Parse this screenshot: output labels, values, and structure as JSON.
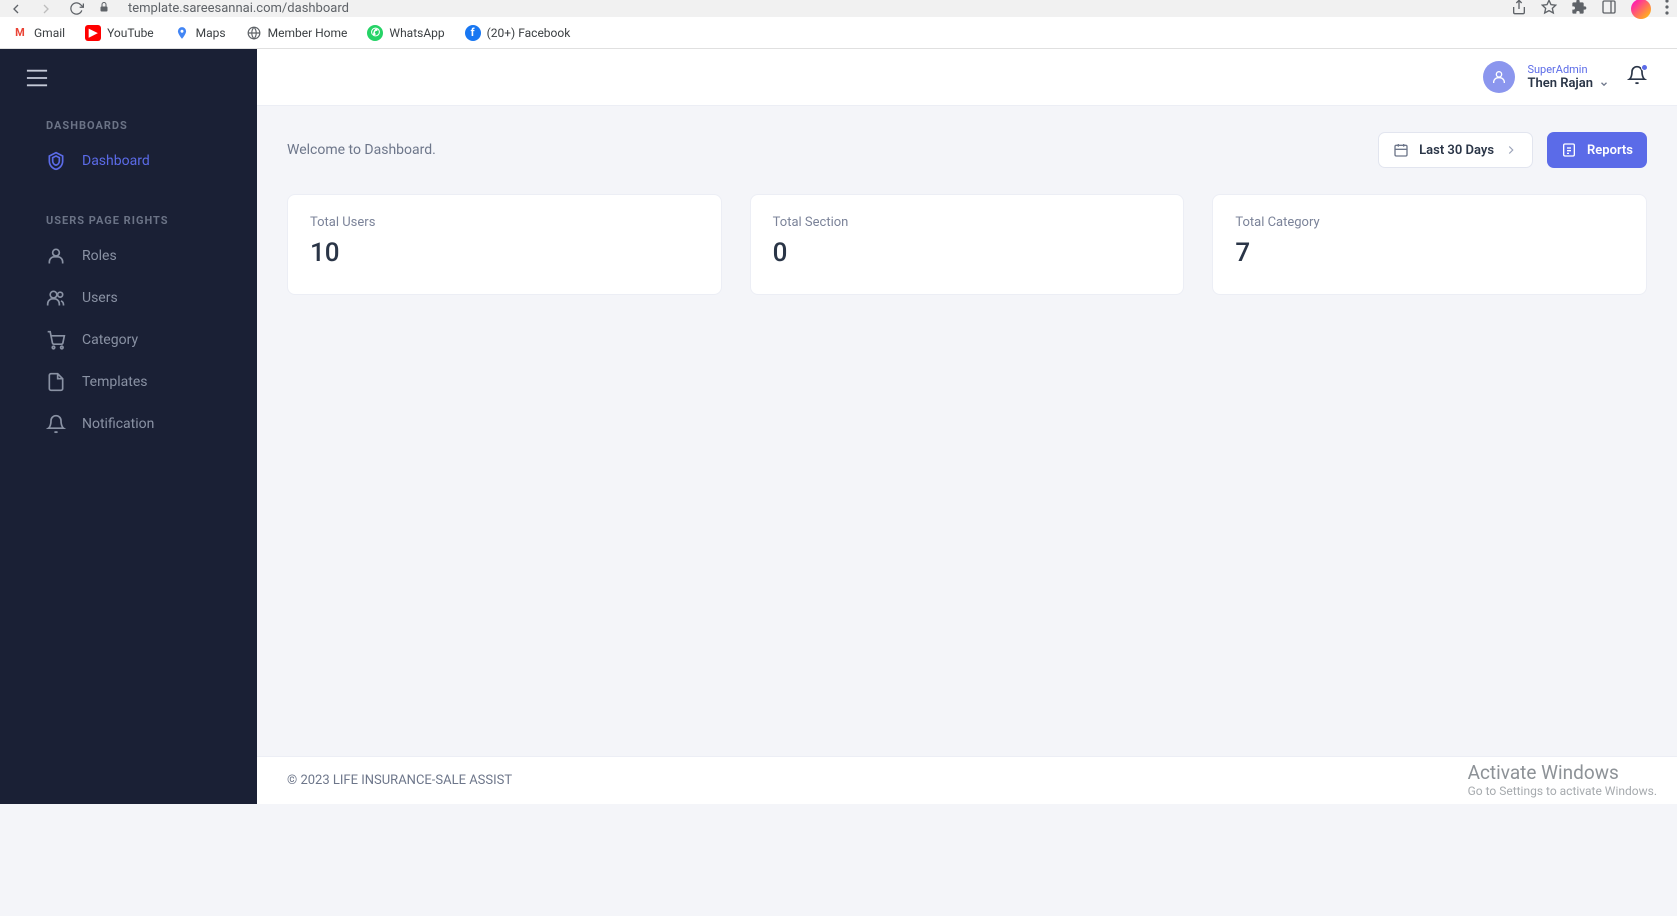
{
  "browser": {
    "url": "template.sareesannai.com/dashboard",
    "bookmarks": [
      {
        "label": "Gmail"
      },
      {
        "label": "YouTube"
      },
      {
        "label": "Maps"
      },
      {
        "label": "Member Home"
      },
      {
        "label": "WhatsApp"
      },
      {
        "label": "(20+) Facebook"
      }
    ]
  },
  "sidebar": {
    "section1": "DASHBOARDS",
    "dashboard": "Dashboard",
    "section2": "USERS PAGE RIGHTS",
    "roles": "Roles",
    "users": "Users",
    "category": "Category",
    "templates": "Templates",
    "notification": "Notification"
  },
  "header": {
    "role": "SuperAdmin",
    "name": "Then Rajan"
  },
  "content": {
    "welcome": "Welcome to Dashboard.",
    "dateRange": "Last 30 Days",
    "reports": "Reports",
    "cards": {
      "users_label": "Total Users",
      "users_value": "10",
      "section_label": "Total Section",
      "section_value": "0",
      "category_label": "Total Category",
      "category_value": "7"
    }
  },
  "footer": "© 2023 LIFE INSURANCE-SALE ASSIST",
  "watermark": {
    "line1": "Activate Windows",
    "line2": "Go to Settings to activate Windows."
  }
}
